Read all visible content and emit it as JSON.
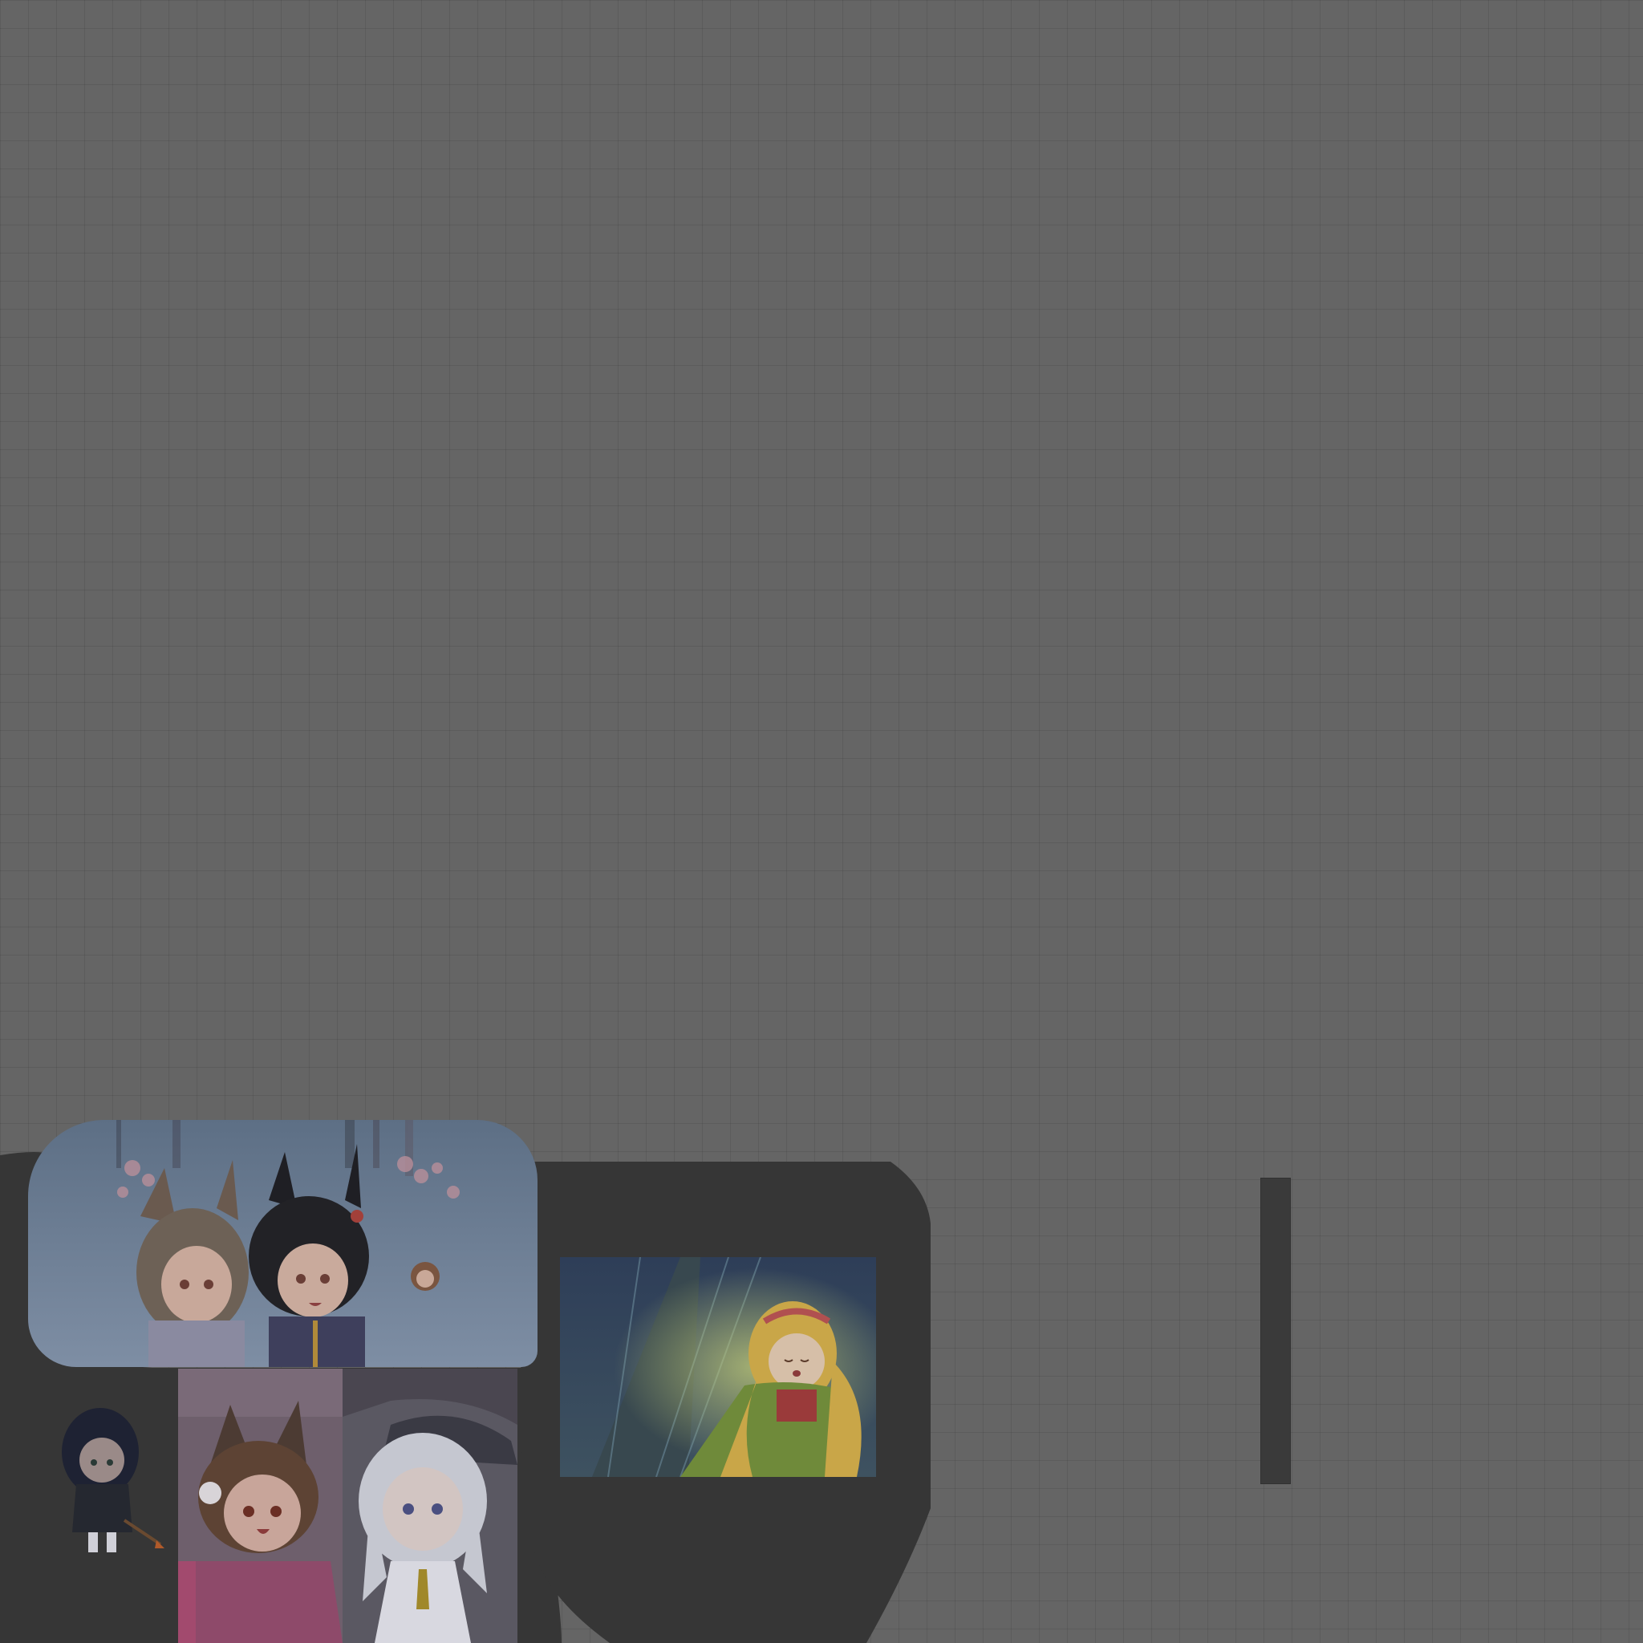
{
  "canvas": {
    "background": "#656565",
    "grid_color": "#5c5c5c",
    "piece_color": "#363636"
  },
  "pieces": [
    {
      "name": "banner-piece",
      "art": "two-horse-girls-with-cherry-blossoms"
    },
    {
      "name": "chibi-warrior-piece",
      "art": "chibi-dark-haired-spear-girl"
    },
    {
      "name": "cat-ear-girl-piece",
      "art": "brown-haired-cat-ear-girl"
    },
    {
      "name": "silver-haired-girl-piece",
      "art": "silver-haired-witch-girl"
    },
    {
      "name": "framed-card-piece",
      "art": "blonde-doll-girl-with-tower"
    },
    {
      "name": "slot-bar-piece",
      "art": "empty-slot"
    }
  ]
}
